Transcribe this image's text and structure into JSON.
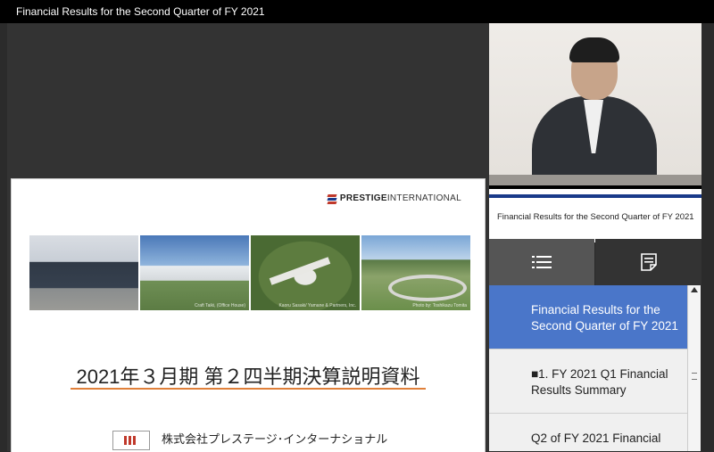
{
  "window": {
    "title": "Financial Results for the Second Quarter of FY 2021"
  },
  "slide": {
    "logo_bold": "PRESTIGE",
    "logo_rest": "INTERNATIONAL",
    "photo_captions": [
      "",
      "Craft Taiki, (Office House)",
      "Kaoru Sasaki/ Yamane & Partners, Inc.",
      "Photo by: Toshikazu Tomita"
    ],
    "title": "2021年３月期 第２四半期決算説明資料",
    "company": "株式会社プレステージ･インターナショナル"
  },
  "video": {
    "caption": "Financial Results for the Second Quarter of FY 2021"
  },
  "tabs": [
    {
      "icon": "list-icon"
    },
    {
      "icon": "notes-icon"
    }
  ],
  "chapters": [
    {
      "line1": "Financial Results for the",
      "line2": "Second Quarter of FY 2021"
    },
    {
      "line1": "■1. FY 2021 Q1 Financial",
      "line2": "Results Summary"
    },
    {
      "line1": "Q2 of FY 2021 Financial",
      "line2": ""
    }
  ]
}
